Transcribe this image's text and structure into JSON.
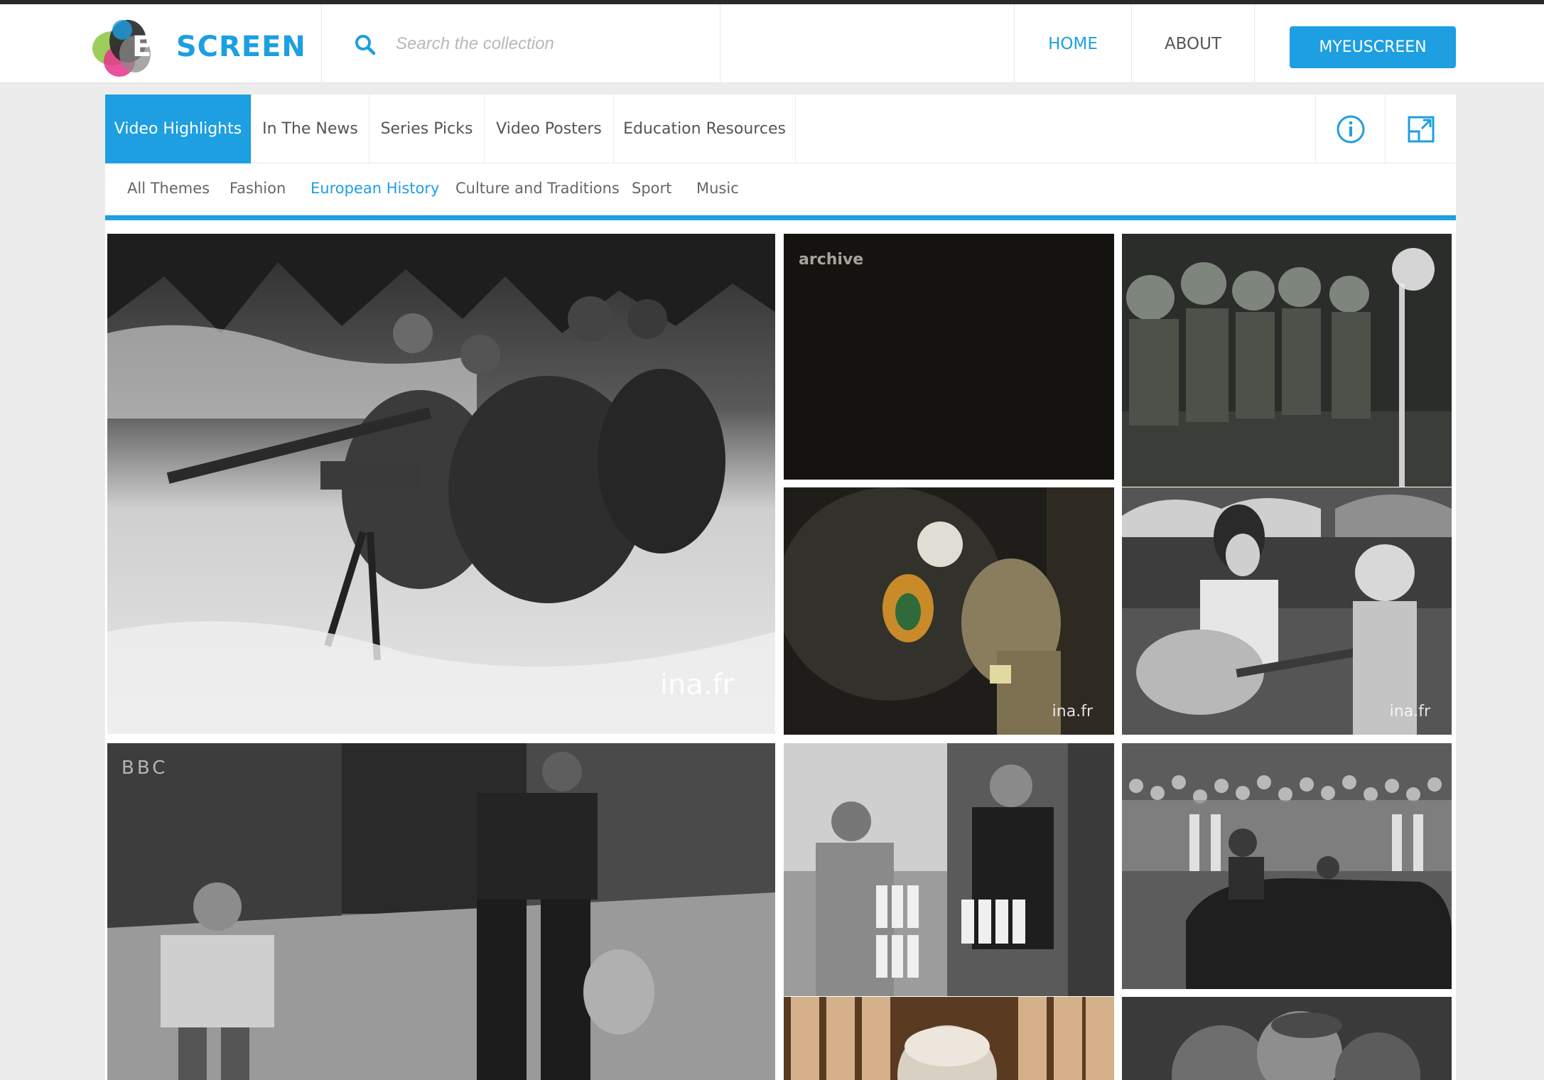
{
  "brand": {
    "logo_eu": "EU",
    "logo_screen": "SCREEN",
    "accent_color": "#1d9fe1"
  },
  "search": {
    "placeholder": "Search the collection",
    "icon": "search-icon"
  },
  "nav": {
    "home": "HOME",
    "about": "ABOUT",
    "my_button": "MYEUSCREEN"
  },
  "tabs": [
    {
      "label": "Video Highlights",
      "active": true
    },
    {
      "label": "In The News",
      "active": false
    },
    {
      "label": "Series Picks",
      "active": false
    },
    {
      "label": "Video Posters",
      "active": false
    },
    {
      "label": "Education Resources",
      "active": false
    }
  ],
  "tools": {
    "info_icon": "info-icon",
    "expand_icon": "expand-icon"
  },
  "themes": [
    {
      "label": "All Themes",
      "active": false
    },
    {
      "label": "Fashion",
      "active": false
    },
    {
      "label": "European History",
      "active": true
    },
    {
      "label": "Culture and Traditions",
      "active": false
    },
    {
      "label": "Sport",
      "active": false
    },
    {
      "label": "Music",
      "active": false
    }
  ],
  "videos": [
    {
      "id": "snow-soldiers",
      "watermark": "ina.fr"
    },
    {
      "id": "archive-dark",
      "watermark": "archive"
    },
    {
      "id": "riot-police",
      "watermark": ""
    },
    {
      "id": "miner",
      "watermark": "ina.fr"
    },
    {
      "id": "guitar-singer",
      "watermark": "ina.fr"
    },
    {
      "id": "boy-street",
      "watermark": "BBC"
    },
    {
      "id": "milk-delivery",
      "watermark": ""
    },
    {
      "id": "parade-car",
      "watermark": ""
    },
    {
      "id": "old-man",
      "watermark": ""
    },
    {
      "id": "faces",
      "watermark": ""
    }
  ]
}
